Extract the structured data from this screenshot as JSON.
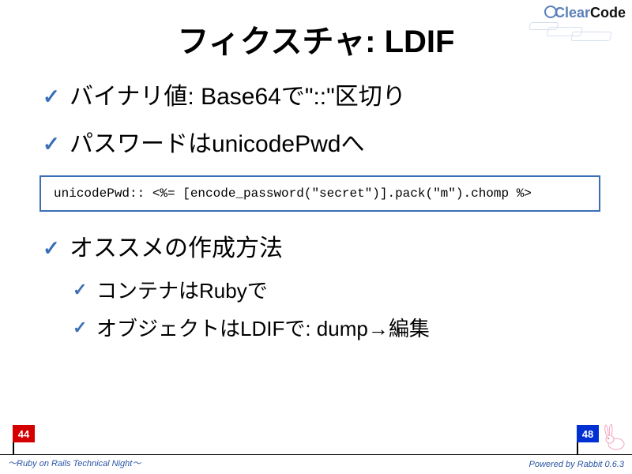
{
  "logo": {
    "part1": "Clear",
    "part2": "Code"
  },
  "title": "フィクスチャ: LDIF",
  "bullets": {
    "b1": "バイナリ値: Base64で\"::\"区切り",
    "b2": "パスワードはunicodePwdへ",
    "b3": "オススメの作成方法",
    "s1": "コンテナはRubyで",
    "s2": "オブジェクトはLDIFで: dump→編集"
  },
  "code": "unicodePwd:: <%= [encode_password(\"secret\")].pack(\"m\").chomp %>",
  "page": {
    "current": "44",
    "total": "48"
  },
  "footer": {
    "left": "～Ruby on Rails Technical Night～",
    "right": "Powered by Rabbit 0.6.3"
  }
}
